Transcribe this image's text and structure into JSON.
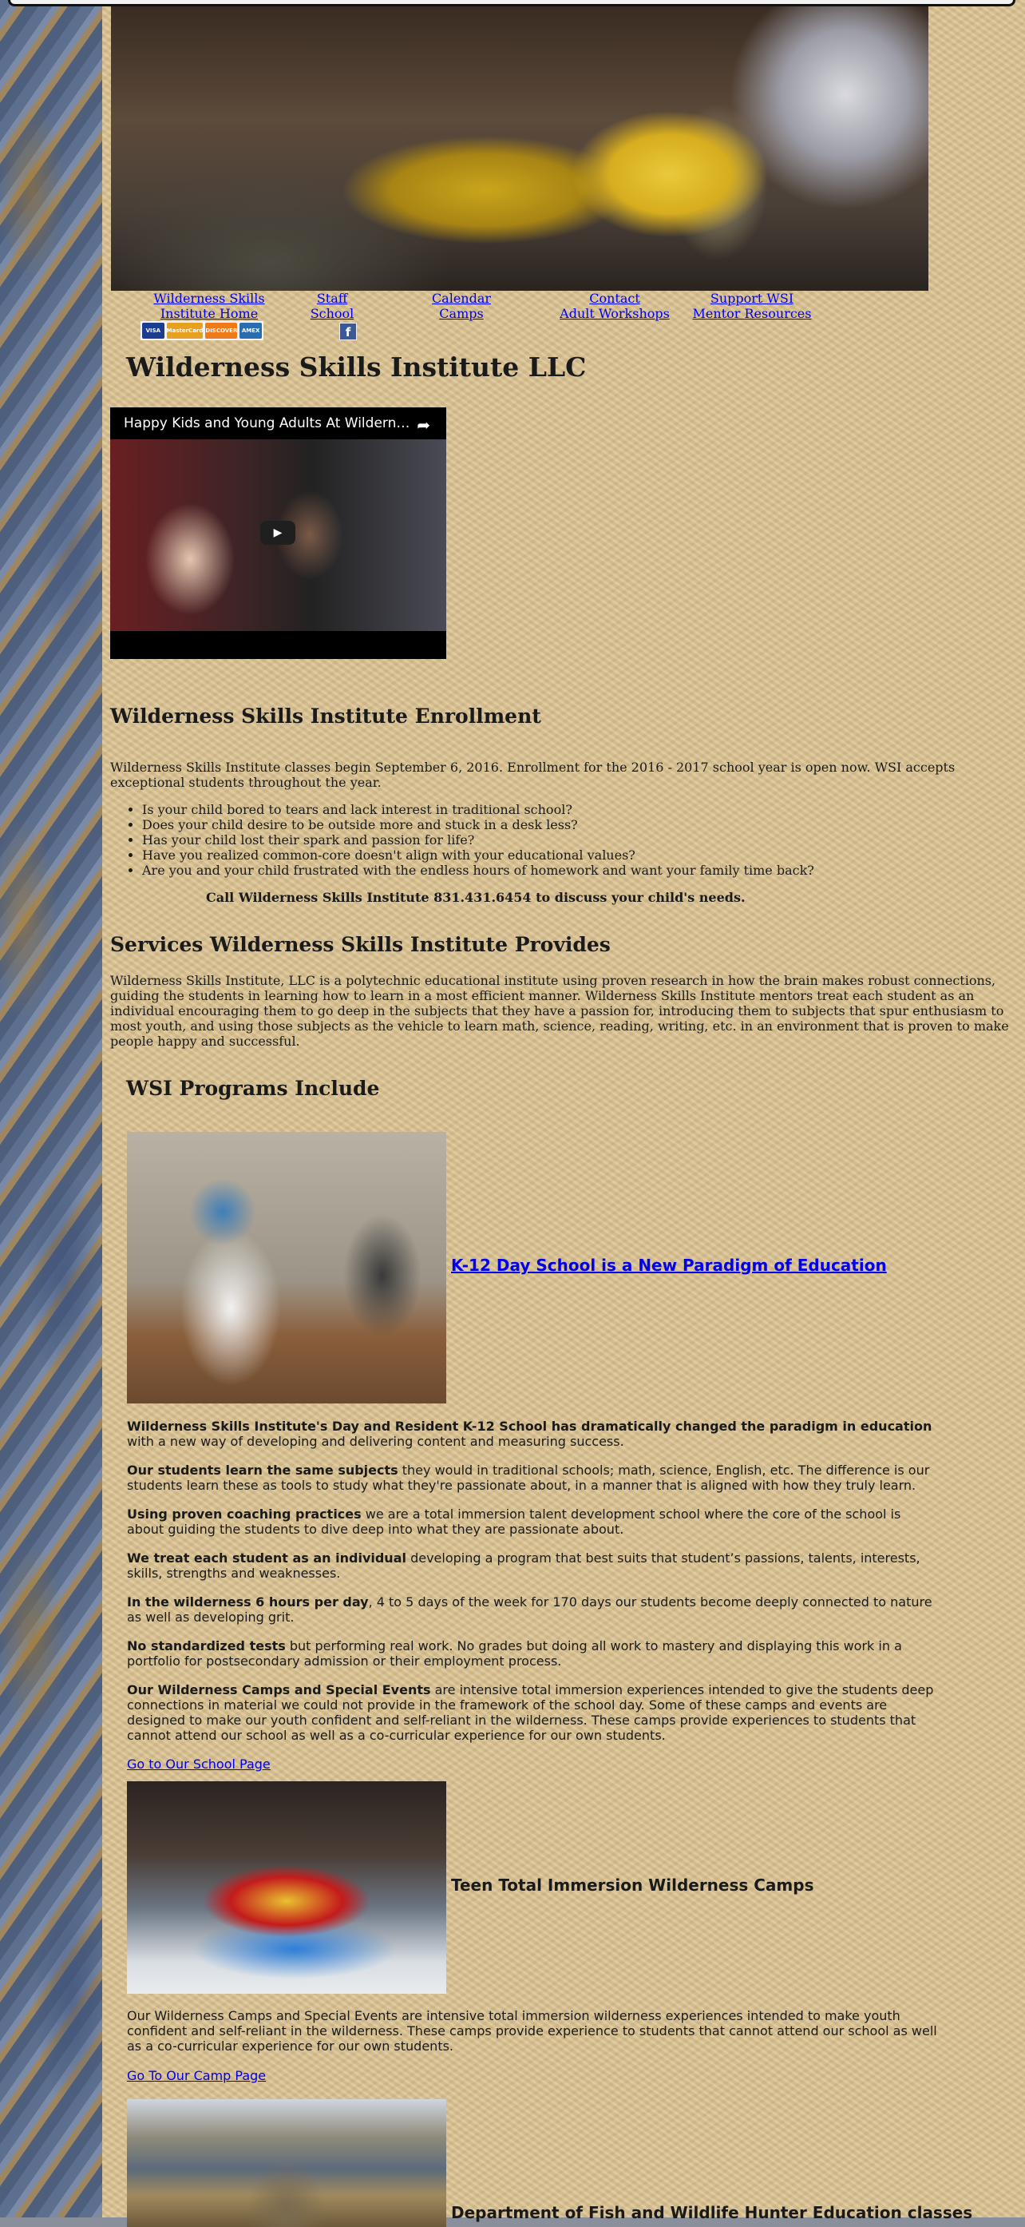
{
  "nav": [
    {
      "line1": "Wilderness Skills",
      "line2": "Institute Home"
    },
    {
      "line1": "Staff",
      "line2": "School"
    },
    {
      "line1": "Calendar",
      "line2": "Camps"
    },
    {
      "line1": "Contact",
      "line2": "Adult Workshops"
    },
    {
      "line1": "Support WSI",
      "line2": "Mentor Resources"
    }
  ],
  "payment_cards": [
    "VISA",
    "MasterCard",
    "DISCOVER",
    "AMEX"
  ],
  "facebook_glyph": "f",
  "page_title": "Wilderness Skills Institute LLC",
  "video": {
    "title": "Happy Kids and Young Adults At Wildernes...",
    "share_glyph": "➦",
    "play_glyph": "▶"
  },
  "enrollment": {
    "heading": "Wilderness Skills Institute Enrollment",
    "intro": "Wilderness Skills Institute classes begin September 6, 2016. Enrollment for the 2016 - 2017 school year is open now. WSI accepts exceptional students throughout the year.",
    "bullets": [
      "Is your child bored to tears and lack interest in traditional school?",
      "Does your child desire to be outside more and stuck in a desk less?",
      "Has your child lost their spark and passion for life?",
      "Have you realized common-core doesn't align with your educational values?",
      "Are you and your child frustrated with the endless hours of homework and want your family time back?"
    ],
    "call": "Call Wilderness Skills Institute 831.431.6454 to discuss your child's needs."
  },
  "services": {
    "heading": "Services Wilderness Skills Institute Provides",
    "body": "Wilderness Skills Institute, LLC is a polytechnic educational institute using proven research in how the brain makes robust connections, guiding the students in learning how to learn in a most efficient manner. Wilderness Skills Institute mentors treat each student as an individual encouraging them to go deep in the subjects that they have a passion for, introducing them to subjects that spur enthusiasm to most youth, and using those subjects as the vehicle to learn math, science, reading, writing, etc. in an environment that is proven to make people happy and successful."
  },
  "programs": {
    "heading": "WSI Programs Include",
    "k12_link": "K-12 Day School is a New Paradigm of Education",
    "paragraphs": [
      {
        "bold": "Wilderness Skills Institute's Day and Resident K-12 School has dramatically changed the paradigm in education",
        "rest": " with a new way of developing and delivering content and measuring success."
      },
      {
        "bold": "Our students learn the same subjects",
        "rest": " they would in traditional schools; math, science, English, etc. The difference is our students learn these as tools to study what they're passionate about, in a manner that is aligned with how they truly learn."
      },
      {
        "bold": "Using proven coaching practices",
        "rest": " we are a total immersion talent development school where the core of the school is about guiding the students to dive deep into what they are passionate about."
      },
      {
        "bold": "We treat each student as an individual",
        "rest": " developing a program that best suits that student’s passions, talents, interests, skills, strengths and weaknesses."
      },
      {
        "bold": "In the wilderness 6 hours per day",
        "rest": ", 4 to 5 days of the week for 170 days our students become deeply connected to nature as well as developing grit."
      },
      {
        "bold": "No standardized tests",
        "rest": " but performing real work. No grades but doing all work to mastery and displaying this work in a portfolio for postsecondary admission or their employment process."
      },
      {
        "bold": "Our Wilderness Camps and Special Events",
        "rest": " are intensive total immersion experiences intended to give the students deep connections in material we could not provide in the framework of the school day. Some of these camps and events are designed to make our youth confident and self-reliant in the wilderness. These camps provide experiences to students that cannot attend our school as well as a co-curricular experience for our own students."
      }
    ],
    "school_link": "Go to Our School Page",
    "camps_heading": "Teen Total Immersion Wilderness Camps",
    "camps_body": "Our Wilderness Camps and Special Events are intensive total immersion wilderness experiences intended to make youth confident and self-reliant in the wilderness. These camps provide experience to students that cannot attend our school as well as a co-curricular experience for our own students.",
    "camp_link": "Go To Our Camp Page",
    "hunter_heading": "Department of Fish and Wildlife Hunter Education classes"
  }
}
